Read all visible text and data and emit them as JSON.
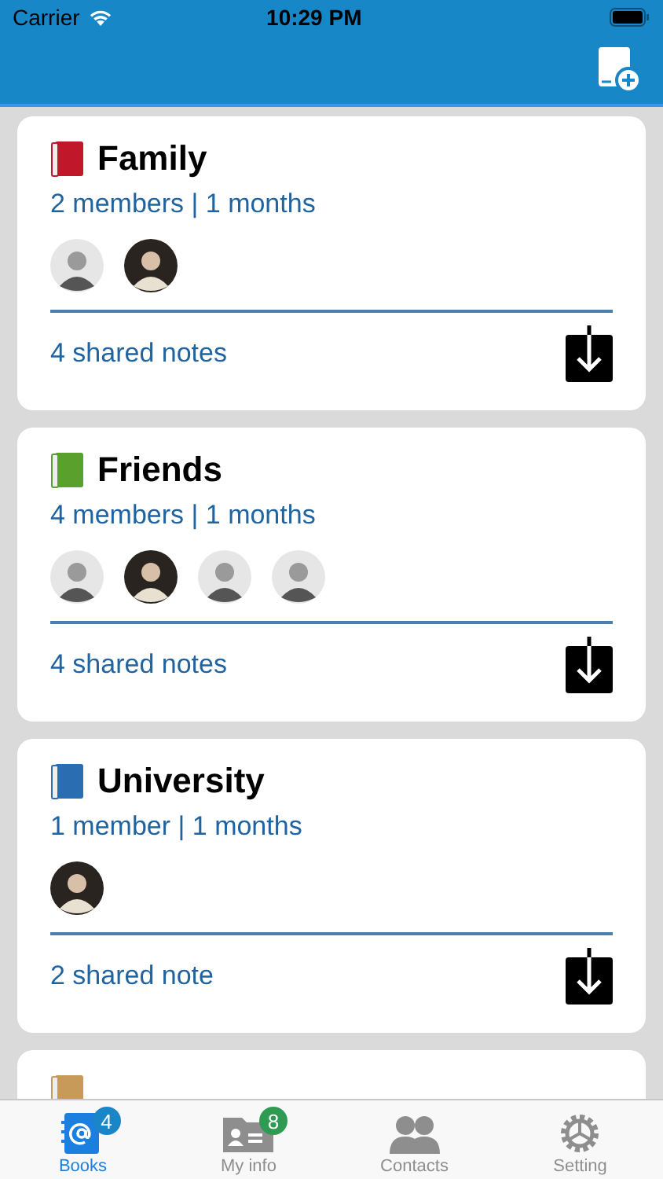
{
  "status_bar": {
    "carrier": "Carrier",
    "time": "10:29 PM"
  },
  "books": [
    {
      "title": "Family",
      "color": "#c0182a",
      "meta": "2 members | 1 months",
      "avatars": [
        {
          "kind": "light"
        },
        {
          "kind": "dark"
        }
      ],
      "notes": "4 shared notes"
    },
    {
      "title": "Friends",
      "color": "#5aa02c",
      "meta": "4 members | 1 months",
      "avatars": [
        {
          "kind": "light"
        },
        {
          "kind": "dark"
        },
        {
          "kind": "light"
        },
        {
          "kind": "light"
        }
      ],
      "notes": "4 shared notes"
    },
    {
      "title": "University",
      "color": "#2a6db0",
      "meta": "1 member | 1 months",
      "avatars": [
        {
          "kind": "dark"
        }
      ],
      "notes": "2 shared note"
    },
    {
      "color": "#c89a5a"
    }
  ],
  "tabs": [
    {
      "label": "Books",
      "selected": true,
      "badge": "4",
      "color": "#1a86c8"
    },
    {
      "label": "My info",
      "selected": false,
      "badge": "8",
      "color": "#2e9a52"
    },
    {
      "label": "Contacts",
      "selected": false
    },
    {
      "label": "Setting",
      "selected": false
    }
  ]
}
